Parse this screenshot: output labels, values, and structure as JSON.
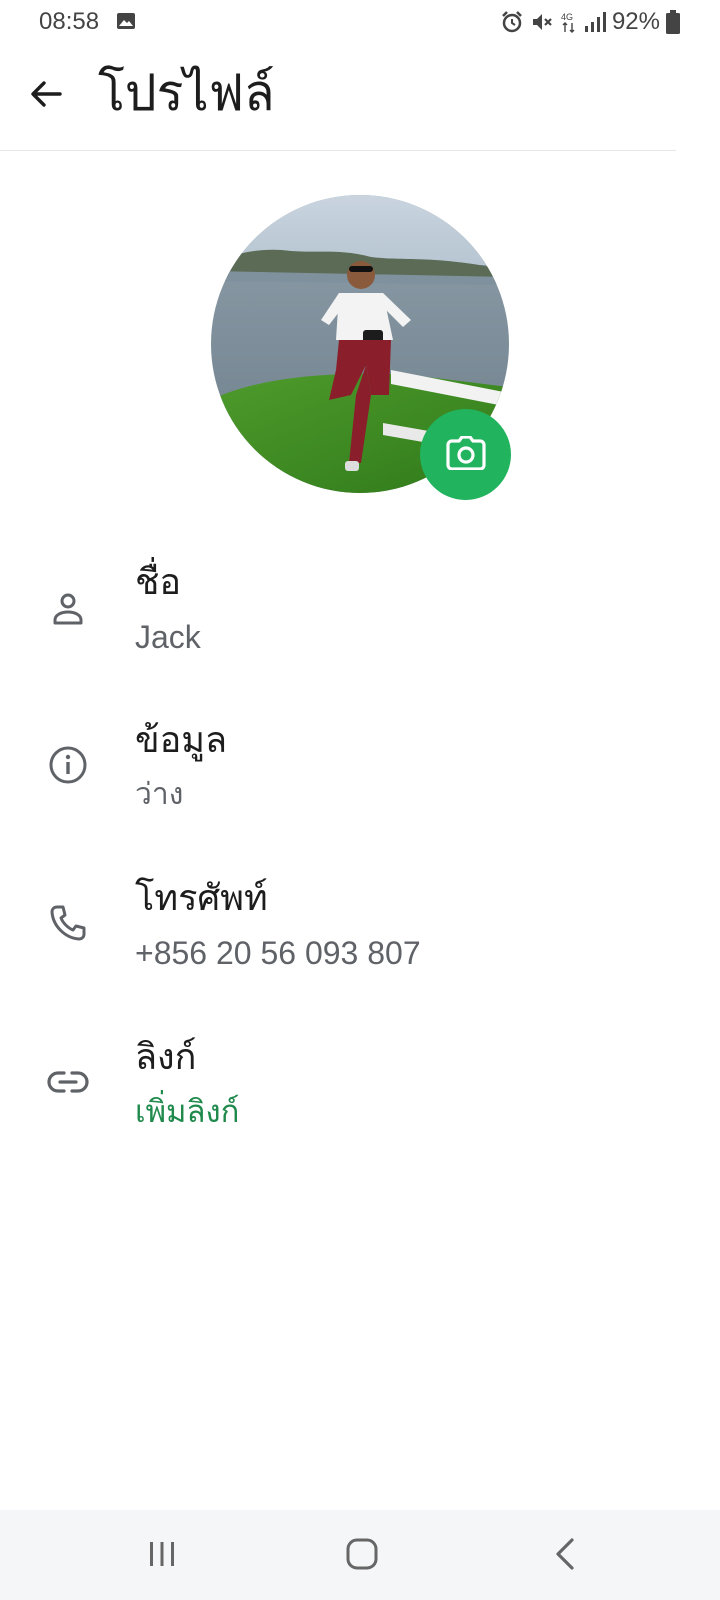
{
  "status_bar": {
    "time": "08:58",
    "battery": "92%",
    "icons": [
      "image-icon",
      "alarm-icon",
      "mute-icon",
      "4g-icon",
      "signal-icon",
      "battery-icon"
    ]
  },
  "header": {
    "title": "โปรไฟล์",
    "back_icon": "arrow-left-icon"
  },
  "profile": {
    "avatar_desc": "profile photo",
    "camera_icon": "camera-icon",
    "accent_color": "#21b35d"
  },
  "fields": [
    {
      "icon": "person-icon",
      "label": "ชื่อ",
      "value": "Jack"
    },
    {
      "icon": "info-icon",
      "label": "ข้อมูล",
      "value": "ว่าง"
    },
    {
      "icon": "phone-icon",
      "label": "โทรศัพท์",
      "value": "+856 20 56 093 807"
    },
    {
      "icon": "link-icon",
      "label": "ลิงก์",
      "value": "เพิ่มลิงก์",
      "value_color": "#1f8a4c"
    }
  ],
  "nav": {
    "items": [
      "recents-icon",
      "home-icon",
      "back-icon"
    ]
  }
}
